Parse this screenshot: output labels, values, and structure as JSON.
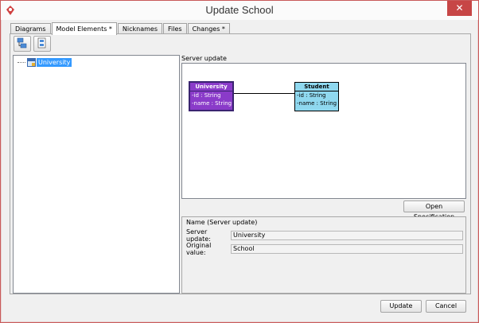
{
  "window": {
    "title": "Update School",
    "close_glyph": "✕"
  },
  "tabs": [
    {
      "label": "Diagrams",
      "active": false
    },
    {
      "label": "Model Elements *",
      "active": true
    },
    {
      "label": "Nicknames",
      "active": false
    },
    {
      "label": "Files",
      "active": false
    },
    {
      "label": "Changes *",
      "active": false
    }
  ],
  "toolbar": {
    "icons": [
      "expand-tree-icon",
      "collapse-tree-icon"
    ]
  },
  "tree": {
    "items": [
      {
        "label": "University",
        "icon": "class-icon",
        "selected": true
      }
    ]
  },
  "diagram": {
    "section_label": "Server update",
    "classes": [
      {
        "name": "University",
        "attributes": [
          "-id : String",
          "-name : String"
        ],
        "color": "#8a3bc9"
      },
      {
        "name": "Student",
        "attributes": [
          "-id : String",
          "-name : String"
        ],
        "color": "#8fd8ef"
      }
    ]
  },
  "open_spec_label": "Open Specification",
  "details": {
    "title": "Name (Server update)",
    "server_update_label": "Server update:",
    "server_update_value": "University",
    "original_value_label": "Original value:",
    "original_value_value": "School"
  },
  "buttons": {
    "update": "Update",
    "cancel": "Cancel"
  }
}
